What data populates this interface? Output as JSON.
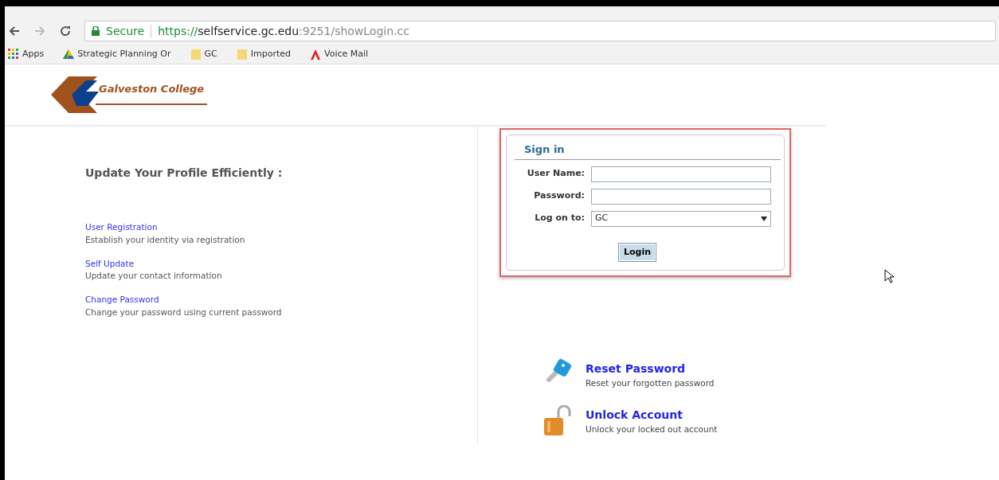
{
  "browser": {
    "secure_label": "Secure",
    "url_scheme": "https://",
    "url_host": "selfservice.gc.edu",
    "url_path": ":9251/showLogin.cc"
  },
  "bookmarks": [
    {
      "kind": "apps",
      "label": "Apps"
    },
    {
      "kind": "drive",
      "label": "Strategic Planning Or"
    },
    {
      "kind": "folder",
      "label": "GC"
    },
    {
      "kind": "folder",
      "label": "Imported"
    },
    {
      "kind": "adobe",
      "label": "Voice Mail"
    }
  ],
  "logo": {
    "text": "Galveston College"
  },
  "profile": {
    "heading": "Update Your Profile Efficiently :",
    "links": [
      {
        "label": "User Registration",
        "description": "Establish your identity via registration"
      },
      {
        "label": "Self Update",
        "description": "Update your contact information"
      },
      {
        "label": "Change Password",
        "description": "Change your password using current password"
      }
    ]
  },
  "signin": {
    "title": "Sign in",
    "fields": [
      {
        "kind": "text",
        "label": "User Name:"
      },
      {
        "kind": "password",
        "label": "Password:"
      },
      {
        "kind": "select",
        "label": "Log on to:",
        "value": "GC"
      }
    ],
    "button": "Login"
  },
  "actions": [
    {
      "kind": "key",
      "label": "Reset Password",
      "description": "Reset your forgotten password"
    },
    {
      "kind": "lock",
      "label": "Unlock Account",
      "description": "Unlock your locked out account"
    }
  ]
}
